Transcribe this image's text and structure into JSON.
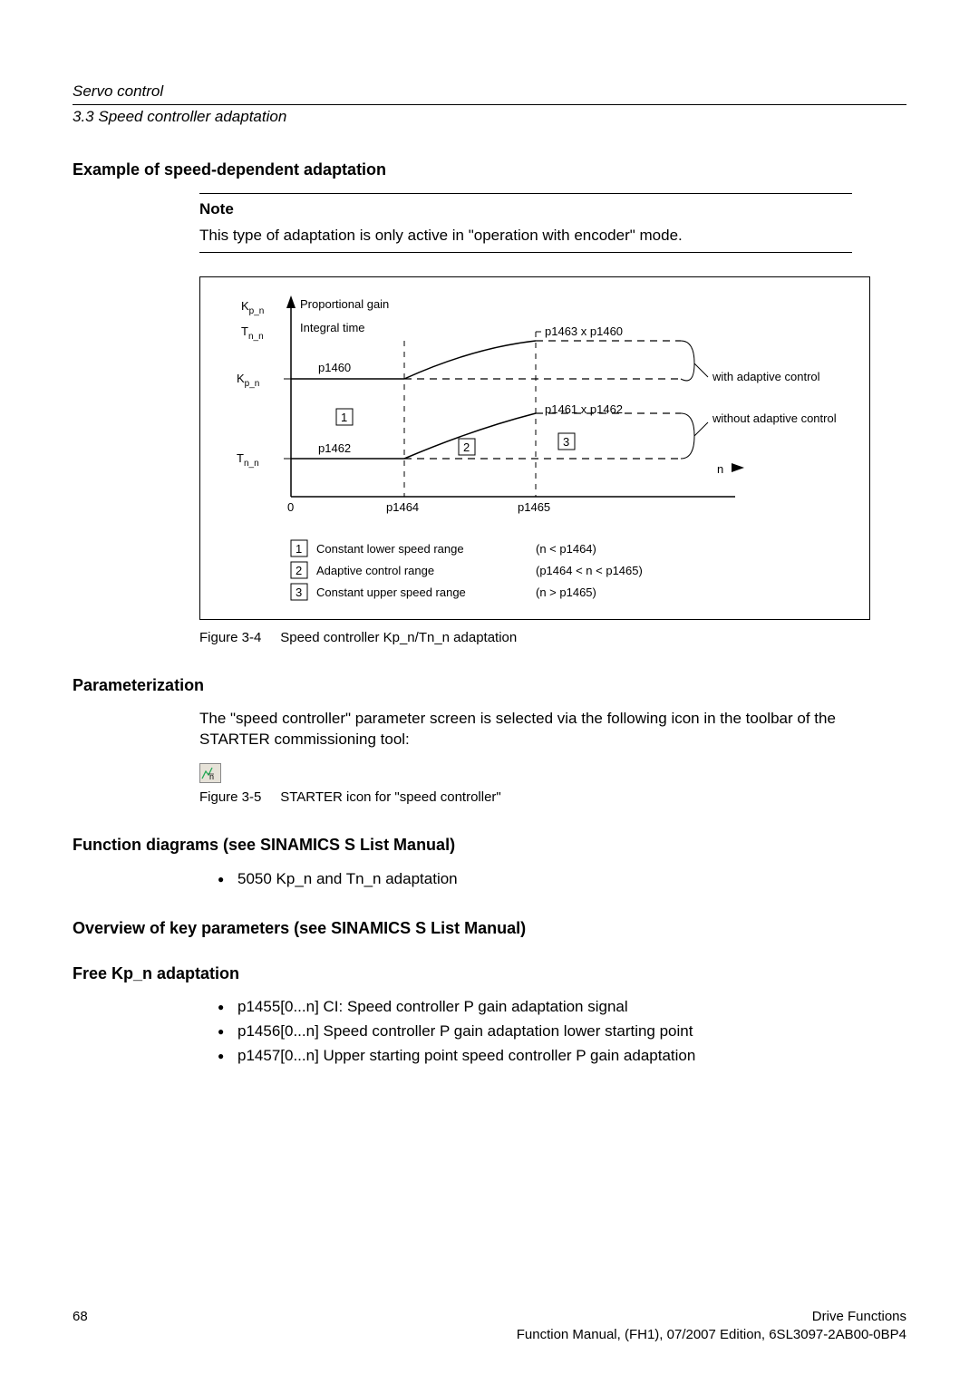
{
  "header": {
    "title": "Servo control",
    "section": "3.3 Speed controller adaptation"
  },
  "sections": {
    "example_heading": "Example of speed-dependent adaptation",
    "note_title": "Note",
    "note_body": "This type of adaptation is only active in \"operation with encoder\" mode.",
    "fig34_caption_label": "Figure 3-4",
    "fig34_caption_text": "Speed controller Kp_n/Tn_n adaptation",
    "param_heading": "Parameterization",
    "param_body": "The \"speed controller\" parameter screen is selected via the following icon in the toolbar of the STARTER commissioning tool:",
    "fig35_caption_label": "Figure 3-5",
    "fig35_caption_text": "STARTER icon for \"speed controller\"",
    "func_heading": "Function diagrams (see SINAMICS S List Manual)",
    "func_bullet": "5050 Kp_n and Tn_n adaptation",
    "overview_heading": "Overview of key parameters (see SINAMICS S List Manual)",
    "free_heading": "Free Kp_n adaptation",
    "free_bullets": [
      "p1455[0...n] CI: Speed controller P gain adaptation signal",
      "p1456[0...n] Speed controller P gain adaptation lower starting point",
      "p1457[0...n] Upper starting point speed controller P gain adaptation"
    ]
  },
  "diagram": {
    "y_kpn": "K",
    "y_kpn_sub": "p_n",
    "y_kpn_desc": "Proportional gain",
    "y_tnn": "T",
    "y_tnn_sub": "n_n",
    "y_tnn_desc": "Integral time",
    "p1460": "p1460",
    "p1462": "p1462",
    "p1464": "p1464",
    "p1465": "p1465",
    "p1463x1460": "p1463 x p1460",
    "p1461x1462": "p1461 x p1462",
    "with_adaptive": "with adaptive control",
    "without_adaptive": "without adaptive control",
    "n_label": "n",
    "zero": "0",
    "legend1_label": "Constant lower speed range",
    "legend1_cond": "(n < p1464)",
    "legend2_label": "Adaptive control range",
    "legend2_cond": "(p1464 < n < p1465)",
    "legend3_label": "Constant upper speed range",
    "legend3_cond": "(n > p1465)"
  },
  "chart_data": {
    "type": "line",
    "title": "Speed controller Kp_n/Tn_n adaptation",
    "xlabel": "n",
    "ylabel": "",
    "x_ticks": [
      "0",
      "p1464",
      "p1465"
    ],
    "series": [
      {
        "name": "Kp_n (p1460 constant, without adaptive)",
        "type": "dashed",
        "points": [
          [
            0,
            "p1460"
          ],
          [
            "p1464",
            "p1460"
          ],
          [
            "p1465",
            "p1460"
          ],
          [
            "end",
            "p1460"
          ]
        ]
      },
      {
        "name": "Kp_n (with adaptive)",
        "type": "solid",
        "points": [
          [
            0,
            "p1460"
          ],
          [
            "p1464",
            "p1460"
          ],
          [
            "p1465",
            "p1463 x p1460"
          ],
          [
            "end",
            "p1463 x p1460"
          ]
        ]
      },
      {
        "name": "Tn_n (p1462 constant, without adaptive)",
        "type": "dashed",
        "points": [
          [
            0,
            "p1462"
          ],
          [
            "p1464",
            "p1462"
          ],
          [
            "p1465",
            "p1462"
          ],
          [
            "end",
            "p1462"
          ]
        ]
      },
      {
        "name": "Tn_n (with adaptive)",
        "type": "solid",
        "points": [
          [
            0,
            "p1462"
          ],
          [
            "p1464",
            "p1462"
          ],
          [
            "p1465",
            "p1461 x p1462"
          ],
          [
            "end",
            "p1461 x p1462"
          ]
        ]
      }
    ],
    "regions": [
      {
        "id": 1,
        "name": "Constant lower speed range",
        "condition": "n < p1464"
      },
      {
        "id": 2,
        "name": "Adaptive control range",
        "condition": "p1464 < n < p1465"
      },
      {
        "id": 3,
        "name": "Constant upper speed range",
        "condition": "n > p1465"
      }
    ]
  },
  "footer": {
    "page": "68",
    "right1": "Drive Functions",
    "right2": "Function Manual, (FH1), 07/2007 Edition, 6SL3097-2AB00-0BP4"
  }
}
